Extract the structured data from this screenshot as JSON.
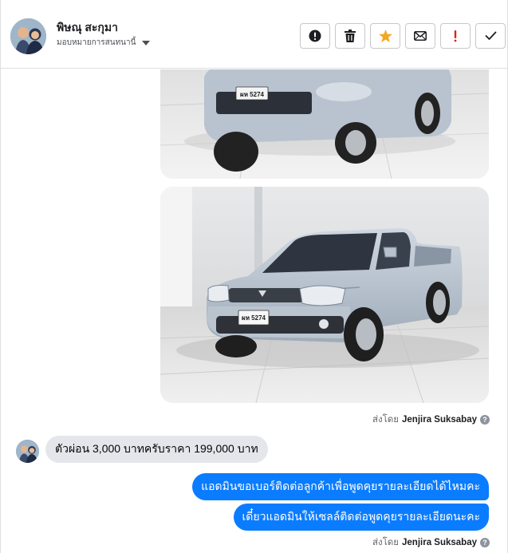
{
  "header": {
    "contact_name": "พิษณุ สะกุมา",
    "assign_label": "มอบหมายการสนทนานี้",
    "actions": [
      {
        "name": "report-spam-button",
        "icon": "exclamation-circle-icon"
      },
      {
        "name": "delete-button",
        "icon": "trash-icon"
      },
      {
        "name": "star-button",
        "icon": "star-icon",
        "color": "#f5a623"
      },
      {
        "name": "mark-unread-button",
        "icon": "envelope-icon"
      },
      {
        "name": "follow-up-button",
        "icon": "exclamation-icon",
        "color": "#e02020"
      },
      {
        "name": "mark-done-button",
        "icon": "check-icon"
      }
    ]
  },
  "thread": {
    "sent_by_prefix": "ส่งโดย",
    "sent_by_name": "Jenjira Suksabay",
    "incoming_message": "ตัวผ่อน 3,000 บาทครับราคา 199,000 บาท",
    "outgoing_messages": [
      "แอดมินขอเบอร์ติดต่อลูกค้าเพื่อพูดคุยรายละเอียดได้ไหมคะ",
      "เดี๋ยวแอดมินให้เซลล์ติดต่อพูดคุยรายละเอียดนะคะ"
    ],
    "plate_text": "ผห 5274"
  },
  "colors": {
    "outgoing_bubble": "#0a7cff",
    "incoming_bubble": "#e4e6eb",
    "star": "#f5a623",
    "alert": "#e02020"
  }
}
